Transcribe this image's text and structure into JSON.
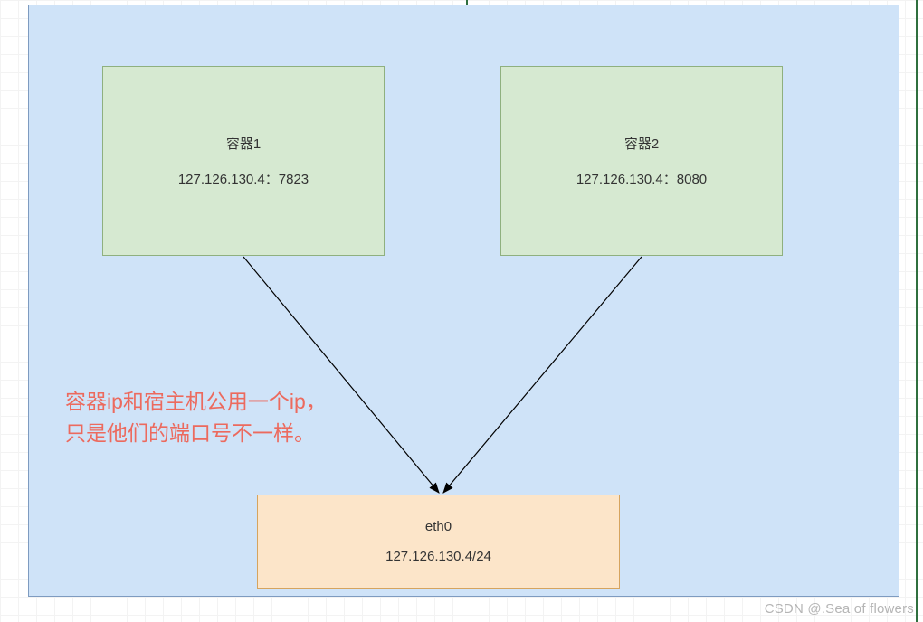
{
  "container1": {
    "title": "容器1",
    "addr": "127.126.130.4：7823"
  },
  "container2": {
    "title": "容器2",
    "addr": "127.126.130.4：8080"
  },
  "eth0": {
    "title": "eth0",
    "addr": "127.126.130.4/24"
  },
  "caption": {
    "line1": "容器ip和宿主机公用一个ip，",
    "line2": "只是他们的端口号不一样。"
  },
  "watermark": "CSDN @.Sea of flowers"
}
